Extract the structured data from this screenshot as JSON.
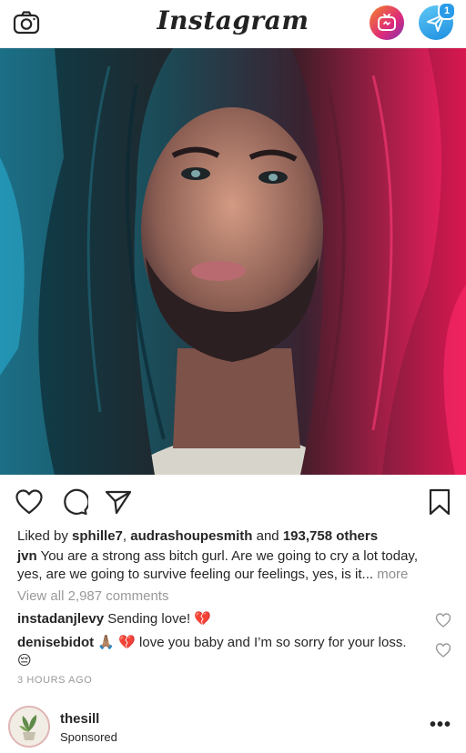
{
  "app": {
    "brand": "Instagram"
  },
  "topbar": {
    "camera_icon": "camera-icon",
    "igtv_icon": "igtv-icon",
    "direct_icon": "direct-message-icon",
    "direct_badge": "1"
  },
  "post": {
    "likes": {
      "prefix": "Liked by ",
      "user1": "sphille7",
      "separator": ", ",
      "user2": "audrashoupesmith",
      "middle": " and ",
      "count": "193,758 others"
    },
    "caption": {
      "username": "jvn",
      "text": " You are a strong ass bitch gurl. Are we going to cry a lot today, yes, are we going to survive feeling our feelings, yes, is it... ",
      "more": "more"
    },
    "view_all_comments": "View all 2,987 comments",
    "comments": [
      {
        "username": "instadanjlevy",
        "text": " Sending love! ",
        "emoji": "💔"
      },
      {
        "username": "denisebidot",
        "emoji_prefix": " 🙏🏽 💔 ",
        "text": "love you baby and I’m so sorry for your loss.",
        "emoji_suffix": "😔"
      }
    ],
    "timestamp": "3 HOURS AGO"
  },
  "actions": {
    "like_icon": "heart-icon",
    "comment_icon": "comment-icon",
    "share_icon": "share-icon",
    "save_icon": "bookmark-icon"
  },
  "sponsored": {
    "username": "thesill",
    "label": "Sponsored",
    "more": "•••"
  },
  "colors": {
    "igtv_gradient_start": "#f58529",
    "igtv_gradient_end": "#8134af",
    "direct_blue": "#2a9be8",
    "text": "#262626",
    "muted": "#8e8e8e"
  }
}
